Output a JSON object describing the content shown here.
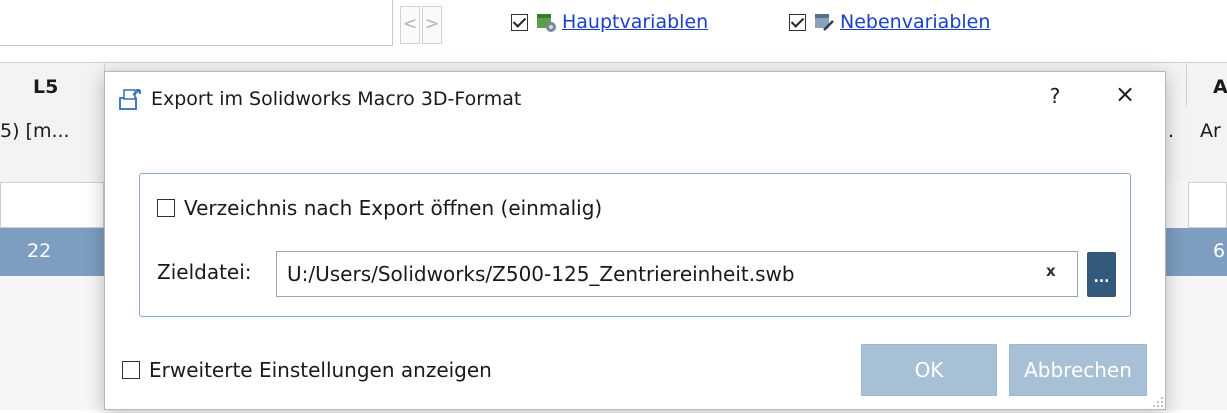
{
  "toolbar": {
    "prev_label": "<",
    "next_label": ">",
    "main_vars_label": "Hauptvariablen",
    "side_vars_label": "Nebenvariablen",
    "main_vars_checked": true,
    "side_vars_checked": true
  },
  "table": {
    "col_header_left": "L5",
    "col_subheader_left": "5) [m...",
    "col_header_right": "A",
    "col_subheader_right_dot": ".",
    "col_subheader_right": "Ar",
    "selected_row_left": "22",
    "selected_row_right": "6",
    "selected_row_color": "#7d9ec0"
  },
  "dialog": {
    "title": "Export im Solidworks Macro 3D-Format",
    "help_label": "?",
    "close_label": "×",
    "open_dir_label": "Verzeichnis nach Export öffnen (einmalig)",
    "open_dir_checked": false,
    "target_label": "Zieldatei:",
    "target_value": "U:/Users/Solidworks/Z500-125_Zentriereinheit.swb",
    "clear_label": "x",
    "browse_label": "...",
    "advanced_label": "Erweiterte Einstellungen anzeigen",
    "advanced_checked": false,
    "ok_label": "OK",
    "cancel_label": "Abbrechen",
    "accent_color": "#33597c",
    "button_color": "#a8c0d6"
  }
}
